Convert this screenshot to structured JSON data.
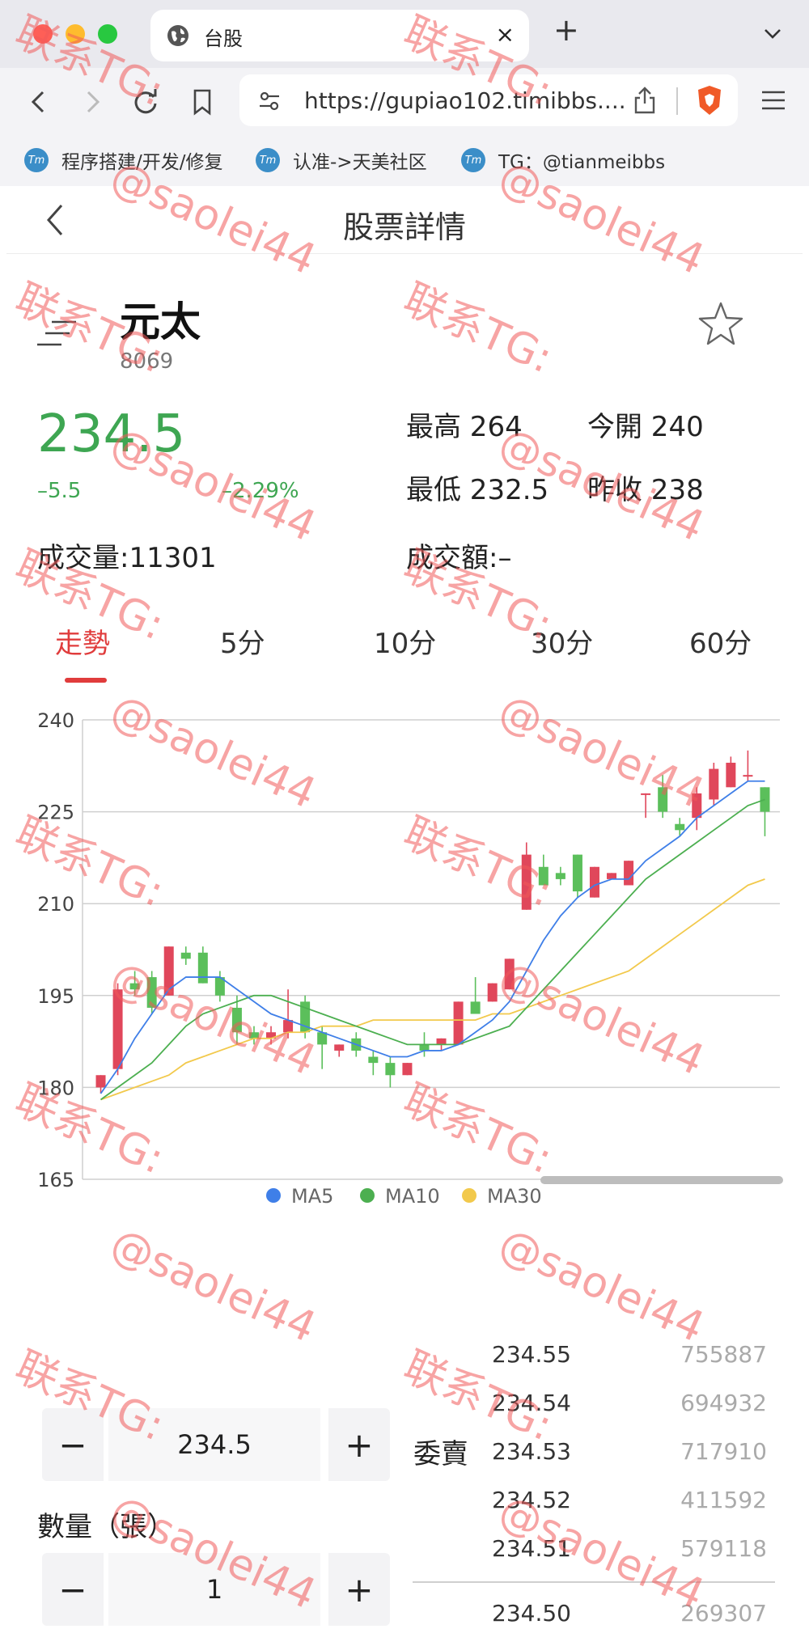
{
  "browser": {
    "tab_title": "台股",
    "tab_close": "×",
    "new_tab": "+",
    "url": "https://gupiao102.timibbs....",
    "bookmarks": [
      {
        "icon": "Tm",
        "label": "程序搭建/开发/修复"
      },
      {
        "icon": "Tm",
        "label": "认准->天美社区"
      },
      {
        "icon": "Tm",
        "label": "TG：@tianmeibbs"
      }
    ]
  },
  "header": {
    "title": "股票詳情"
  },
  "stock": {
    "name": "元太",
    "code": "8069",
    "price": "234.5",
    "change": "–5.5",
    "change_pct": "–2.29%",
    "high": "最高 264",
    "open": "今開 240",
    "low": "最低 232.5",
    "prev_close": "昨收 238",
    "volume": "成交量:11301",
    "amount": "成交額:–"
  },
  "period_tabs": [
    "走勢",
    "5分",
    "10分",
    "30分",
    "60分"
  ],
  "active_tab": 0,
  "colors": {
    "up": "#e0475b",
    "down": "#5bbf5b",
    "ma5": "#3f7fe8",
    "ma10": "#4caf50",
    "ma30": "#f2c94c",
    "accent_red": "#e03c3c",
    "price_green": "#3ea652"
  },
  "chart_data": {
    "type": "candlestick",
    "ylim": [
      165,
      240
    ],
    "yticks": [
      "240",
      "225",
      "210",
      "195",
      "180",
      "165"
    ],
    "legend": [
      "MA5",
      "MA10",
      "MA30"
    ],
    "candles": [
      {
        "o": 180,
        "h": 182,
        "l": 179,
        "c": 182
      },
      {
        "o": 183,
        "h": 197,
        "l": 182,
        "c": 196
      },
      {
        "o": 197,
        "h": 199,
        "l": 195,
        "c": 196
      },
      {
        "o": 198,
        "h": 199,
        "l": 192,
        "c": 193
      },
      {
        "o": 195,
        "h": 203,
        "l": 195,
        "c": 203
      },
      {
        "o": 202,
        "h": 203,
        "l": 200,
        "c": 201
      },
      {
        "o": 202,
        "h": 203,
        "l": 197,
        "c": 197
      },
      {
        "o": 198,
        "h": 199,
        "l": 194,
        "c": 195
      },
      {
        "o": 193,
        "h": 195,
        "l": 187,
        "c": 189
      },
      {
        "o": 189,
        "h": 190,
        "l": 187,
        "c": 188
      },
      {
        "o": 188,
        "h": 190,
        "l": 187,
        "c": 189
      },
      {
        "o": 189,
        "h": 196,
        "l": 188,
        "c": 191
      },
      {
        "o": 194,
        "h": 195,
        "l": 188,
        "c": 189
      },
      {
        "o": 189,
        "h": 190,
        "l": 183,
        "c": 187
      },
      {
        "o": 186,
        "h": 187,
        "l": 185,
        "c": 187
      },
      {
        "o": 188,
        "h": 189,
        "l": 185,
        "c": 186
      },
      {
        "o": 185,
        "h": 186,
        "l": 182,
        "c": 184
      },
      {
        "o": 184,
        "h": 185,
        "l": 180,
        "c": 182
      },
      {
        "o": 182,
        "h": 184,
        "l": 182,
        "c": 184
      },
      {
        "o": 187,
        "h": 189,
        "l": 185,
        "c": 186
      },
      {
        "o": 187,
        "h": 188,
        "l": 186,
        "c": 188
      },
      {
        "o": 187,
        "h": 194,
        "l": 187,
        "c": 194
      },
      {
        "o": 194,
        "h": 198,
        "l": 193,
        "c": 192
      },
      {
        "o": 194,
        "h": 197,
        "l": 194,
        "c": 197
      },
      {
        "o": 196,
        "h": 201,
        "l": 196,
        "c": 201
      },
      {
        "o": 209,
        "h": 220,
        "l": 209,
        "c": 218
      },
      {
        "o": 216,
        "h": 218,
        "l": 213,
        "c": 213
      },
      {
        "o": 215,
        "h": 216,
        "l": 213,
        "c": 214
      },
      {
        "o": 218,
        "h": 218,
        "l": 211,
        "c": 212
      },
      {
        "o": 211,
        "h": 216,
        "l": 211,
        "c": 216
      },
      {
        "o": 214,
        "h": 215,
        "l": 214,
        "c": 215
      },
      {
        "o": 213,
        "h": 217,
        "l": 214,
        "c": 217
      },
      {
        "o": 228,
        "h": 228,
        "l": 224,
        "c": 228
      },
      {
        "o": 229,
        "h": 231,
        "l": 224,
        "c": 225
      },
      {
        "o": 223,
        "h": 224,
        "l": 221,
        "c": 222
      },
      {
        "o": 224,
        "h": 229,
        "l": 222,
        "c": 228
      },
      {
        "o": 227,
        "h": 233,
        "l": 226,
        "c": 232
      },
      {
        "o": 229,
        "h": 234,
        "l": 229,
        "c": 233
      },
      {
        "o": 231,
        "h": 235,
        "l": 230,
        "c": 231
      },
      {
        "o": 229,
        "h": 229,
        "l": 221,
        "c": 225
      }
    ],
    "ma5": [
      179,
      183,
      188,
      192,
      196,
      198,
      198,
      198,
      196,
      194,
      192,
      191,
      190,
      189,
      188,
      187,
      186,
      185,
      185,
      186,
      186,
      187,
      189,
      191,
      194,
      199,
      204,
      208,
      211,
      213,
      214,
      214,
      217,
      219,
      221,
      224,
      226,
      228,
      230,
      230
    ],
    "ma10": [
      178,
      180,
      182,
      184,
      187,
      190,
      192,
      193,
      194,
      195,
      195,
      194,
      193,
      192,
      191,
      190,
      189,
      188,
      187,
      187,
      187,
      187,
      188,
      189,
      190,
      193,
      196,
      199,
      202,
      205,
      208,
      211,
      214,
      216,
      218,
      220,
      222,
      224,
      226,
      227
    ],
    "ma30": [
      178,
      179,
      180,
      181,
      182,
      184,
      185,
      186,
      187,
      188,
      188,
      189,
      189,
      190,
      190,
      190,
      191,
      191,
      191,
      191,
      191,
      191,
      191,
      192,
      192,
      193,
      194,
      195,
      196,
      197,
      198,
      199,
      201,
      203,
      205,
      207,
      209,
      211,
      213,
      214
    ]
  },
  "order": {
    "price_value": "234.5",
    "qty_label": "數量（張）",
    "qty_value": "1",
    "minus": "−",
    "plus": "+",
    "sell_label": "委賣",
    "order_book": [
      {
        "price": "234.55",
        "qty": "755887"
      },
      {
        "price": "234.54",
        "qty": "694932"
      },
      {
        "price": "234.53",
        "qty": "717910"
      },
      {
        "price": "234.52",
        "qty": "411592"
      },
      {
        "price": "234.51",
        "qty": "579118"
      },
      {
        "price": "234.50",
        "qty": "269307"
      }
    ]
  },
  "watermark": {
    "line1": "联系TG:",
    "line2": "@saolei44"
  }
}
